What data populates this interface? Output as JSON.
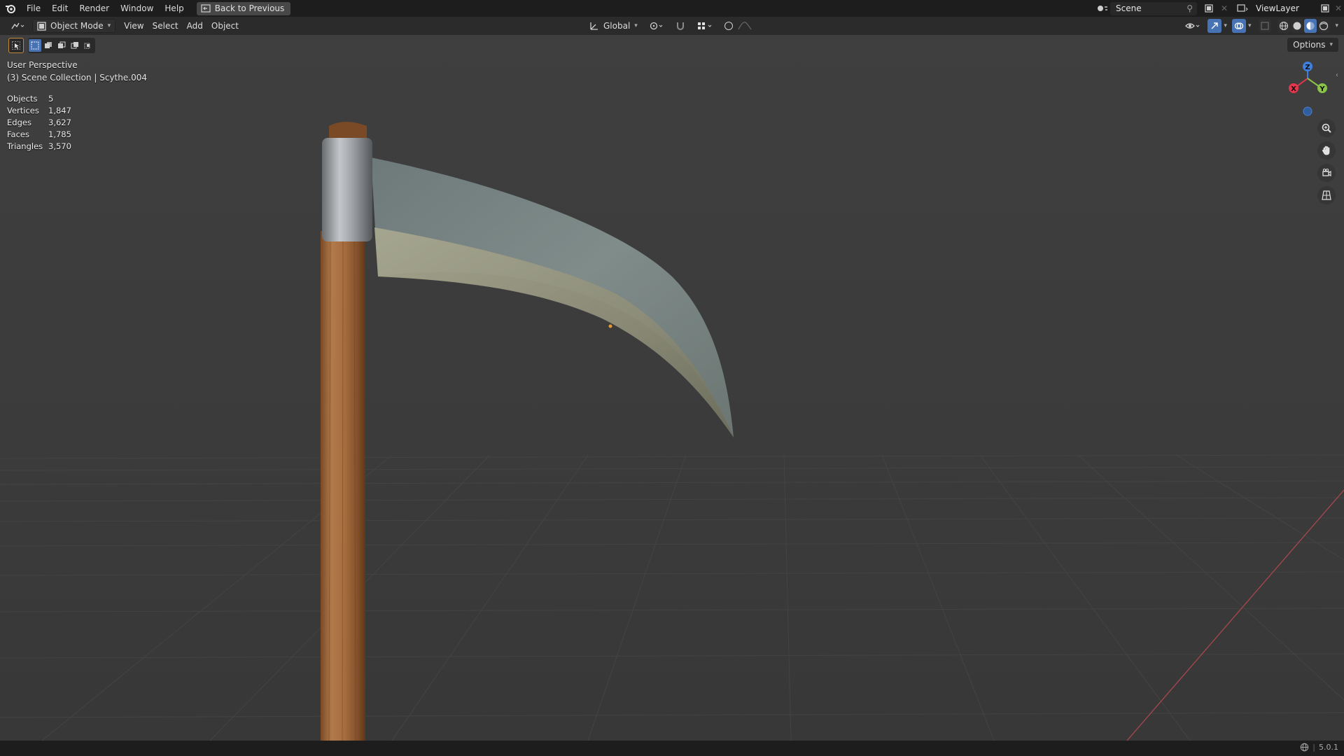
{
  "menubar": {
    "items": [
      "File",
      "Edit",
      "Render",
      "Window",
      "Help"
    ],
    "back_button": "Back to Previous",
    "scene": "Scene",
    "view_layer": "ViewLayer"
  },
  "viewport_header": {
    "mode": "Object Mode",
    "menus": [
      "View",
      "Select",
      "Add",
      "Object"
    ],
    "transform_orientation": "Global",
    "options": "Options"
  },
  "viewport": {
    "perspective": "User Perspective",
    "collection": "(3) Scene Collection | Scythe.004",
    "stats": [
      {
        "label": "Objects",
        "value": "5"
      },
      {
        "label": "Vertices",
        "value": "1,847"
      },
      {
        "label": "Edges",
        "value": "3,627"
      },
      {
        "label": "Faces",
        "value": "1,785"
      },
      {
        "label": "Triangles",
        "value": "3,570"
      }
    ],
    "gizmo": {
      "x": "X",
      "y": "Y",
      "z": "Z"
    }
  },
  "statusbar": {
    "version": "5.0.1"
  },
  "colors": {
    "accent": "#4772b3",
    "axis_x": "#e5364e",
    "axis_y": "#8bc34a",
    "axis_z": "#3f7fe0"
  }
}
